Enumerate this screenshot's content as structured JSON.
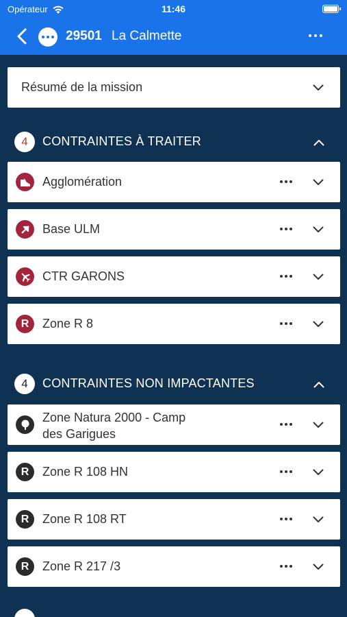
{
  "status_bar": {
    "carrier": "Opérateur",
    "time": "11:46"
  },
  "nav": {
    "mission_id": "29501",
    "mission_name": "La Calmette"
  },
  "summary": {
    "label": "Résumé de la mission"
  },
  "sections": [
    {
      "count": "4",
      "title": "CONTRAINTES À TRAITER",
      "items": [
        {
          "label": "Agglomération",
          "icon": "agglomeration-icon"
        },
        {
          "label": "Base ULM",
          "icon": "ulm-icon"
        },
        {
          "label": "CTR GARONS",
          "icon": "airplane-icon"
        },
        {
          "label": "Zone R 8",
          "icon": "restricted-zone-icon"
        }
      ]
    },
    {
      "count": "4",
      "title": "CONTRAINTES NON IMPACTANTES",
      "items": [
        {
          "label_line1": "Zone Natura 2000 - Camp",
          "label_line2": "des Garigues",
          "icon": "tree-icon"
        },
        {
          "label": "Zone R 108 HN",
          "icon": "restricted-zone-icon"
        },
        {
          "label": "Zone R 108 RT",
          "icon": "restricted-zone-icon"
        },
        {
          "label": "Zone R 217 /3",
          "icon": "restricted-zone-icon"
        }
      ]
    }
  ],
  "colors": {
    "header": "#1a73e8",
    "background": "#0f3152",
    "alert": "#a3243b",
    "neutral": "#2b2b2b"
  }
}
